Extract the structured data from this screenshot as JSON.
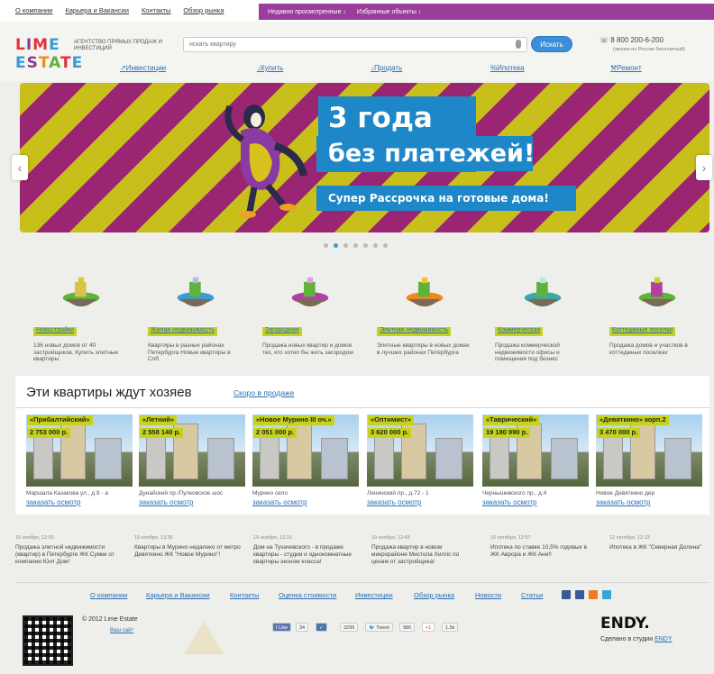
{
  "topbar": {
    "links": [
      "О компании",
      "Карьера и Вакансии",
      "Контакты",
      "Обзор рынка"
    ],
    "recent": "Недавно просмотренные ↓",
    "favorites": "Избранные объекты ↓"
  },
  "header": {
    "logo_line1": [
      "L",
      "I",
      "M",
      "E"
    ],
    "logo_line2": [
      "E",
      "S",
      "T",
      "A",
      "T",
      "E"
    ],
    "tagline": "Агентство прямых продаж и инвестиций",
    "search_placeholder": "искать квартиру",
    "search_button": "Искать",
    "phone": "8 800 200-6-200",
    "phone_note": "(звонок по России бесплатный)"
  },
  "nav": {
    "investments": "Инвестиции",
    "buy": "Купить",
    "sell": "Продать",
    "mortgage": "Ипотека",
    "repair": "Ремонт"
  },
  "banner": {
    "line1": "3 года",
    "line2": "без платежей!",
    "line3": "Супер Рассрочка на готовые дома!",
    "prev": "‹",
    "next": "›",
    "slides": 7,
    "active_slide": 2,
    "colors": {
      "stripe_yellow": "#c9bf1a",
      "stripe_purple": "#9a2673",
      "bubble": "#1e87c8"
    }
  },
  "categories": [
    {
      "label": "Новостройки",
      "desc": "136 новых домов от 40 застройщиков. Купить элитные квартиры",
      "icon": "crane-island-icon"
    },
    {
      "label": "Жилая недвижимость",
      "desc": "Квартиры в разных районах Петербурга Новые квартиры в Спб",
      "icon": "towers-island-icon"
    },
    {
      "label": "Загородная",
      "desc": "Продажа новых квартир и домов тех, кто хотел бы жить загородом",
      "icon": "cottage-island-icon"
    },
    {
      "label": "Элитная недвижимость",
      "desc": "Элитные квартиры в новых домах в лучших районах Петербурга",
      "icon": "elite-island-icon"
    },
    {
      "label": "Коммерческая",
      "desc": "Продажа коммерческой недвижимости офисы и помещения под бизнес",
      "icon": "office-island-icon"
    },
    {
      "label": "Коттеджные поселки",
      "desc": "Продажа домов и участков в коттеджных поселках",
      "icon": "village-island-icon"
    }
  ],
  "listings": {
    "title": "Эти квартиры ждут хозяев",
    "tab": "Скоро в продаже",
    "order_label": "заказать осмотр",
    "items": [
      {
        "name": "«Прибалтийский»",
        "price": "2 753 000 р.",
        "addr": "Маршала Казакова ул., д.9 - а"
      },
      {
        "name": "«Летний»",
        "price": "2 558 140 р.",
        "addr": "Дунайский пр./Пулковское шос"
      },
      {
        "name": "«Новое Мурино III оч.»",
        "price": "2 051 000 р.",
        "addr": "Мурино село"
      },
      {
        "name": "«Оптимист»",
        "price": "3 620 000 р.",
        "addr": "Ленинский пр., д.72 - 1"
      },
      {
        "name": "«Таврический»",
        "price": "19 180 990 р.",
        "addr": "Чернышевского пр., д.4"
      },
      {
        "name": "«Девяткино» корп.2",
        "price": "3 470 000 р.",
        "addr": "Новое Девяткино дер"
      }
    ]
  },
  "news": [
    {
      "date": "19 ноября, 12:50",
      "text": "Продажа элитной недвижимости (квартир) в Петербурге ЖК Сумки от компании Юит Дом!"
    },
    {
      "date": "19 ноября, 13:35",
      "text": "Квартиры в Мурино недалеко от метро Девяткино ЖК \"Новое Мурино\"!"
    },
    {
      "date": "19 ноября, 13:16",
      "text": "Дом на Тухачевского - в продаже квартиры - студии и однокомнатные квартиры эконом класса!"
    },
    {
      "date": "19 ноября, 12:43",
      "text": "Продажа квартир в новом микрорайоне Мистола Хиллс по ценам от застройщика!"
    },
    {
      "date": "16 октября, 12:57",
      "text": "Ипотека по ставке 10,5% годовых в ЖК Аврора и ЖК Ани!!"
    },
    {
      "date": "12 октября, 12:13",
      "text": "Ипотека в ЖК \"Северная Долина\""
    }
  ],
  "footer": {
    "links": [
      "О компании",
      "Карьера и Вакансии",
      "Контакты",
      "Оценка стоимости",
      "Инвестиции",
      "Обзор рынка",
      "Новости",
      "Статьи"
    ],
    "copyright": "© 2012   Lime Estate",
    "our_site": "Ваш сайт",
    "share": {
      "like": "Like",
      "like_count": "34",
      "vk": "✓",
      "vk_count": "3299",
      "tweet": "Tweet",
      "tweet_count": "986",
      "gplus": "+1",
      "gplus_count": "1.5k"
    },
    "studio_logo": "ENDY.",
    "made_by": "Сделано в студии",
    "studio_link": "ENDY"
  }
}
